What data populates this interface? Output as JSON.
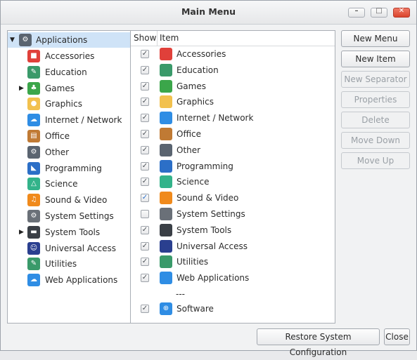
{
  "window": {
    "title": "Main Menu",
    "minimize_glyph": "–",
    "maximize_glyph": "□",
    "close_glyph": "✕"
  },
  "tree": {
    "root": {
      "label": "Applications",
      "icon": "applications-icon"
    },
    "items": [
      {
        "label": "Accessories",
        "icon": "accessories-icon",
        "color": "#e0403a"
      },
      {
        "label": "Education",
        "icon": "education-icon",
        "color": "#3a9a6a"
      },
      {
        "label": "Games",
        "icon": "games-icon",
        "color": "#3ba64a"
      },
      {
        "label": "Graphics",
        "icon": "graphics-icon",
        "color": "#f2c14e"
      },
      {
        "label": "Internet / Network",
        "icon": "internet-icon",
        "color": "#2f8de4"
      },
      {
        "label": "Office",
        "icon": "office-icon",
        "color": "#c07a34"
      },
      {
        "label": "Other",
        "icon": "other-icon",
        "color": "#5a6470"
      },
      {
        "label": "Programming",
        "icon": "programming-icon",
        "color": "#2c6fc7"
      },
      {
        "label": "Science",
        "icon": "science-icon",
        "color": "#33b38a"
      },
      {
        "label": "Sound & Video",
        "icon": "sound-video-icon",
        "color": "#f08a1c"
      },
      {
        "label": "System Settings",
        "icon": "system-settings-icon",
        "color": "#6a7078"
      },
      {
        "label": "System Tools",
        "icon": "system-tools-icon",
        "color": "#3a3f46"
      },
      {
        "label": "Universal Access",
        "icon": "universal-access-icon",
        "color": "#2a3f8f"
      },
      {
        "label": "Utilities",
        "icon": "utilities-icon",
        "color": "#3a9a6a"
      },
      {
        "label": "Web Applications",
        "icon": "web-applications-icon",
        "color": "#2f8de4"
      }
    ]
  },
  "list": {
    "header_show": "Show",
    "header_item": "Item",
    "rows": [
      {
        "label": "Accessories",
        "checked": true
      },
      {
        "label": "Education",
        "checked": true
      },
      {
        "label": "Games",
        "checked": true
      },
      {
        "label": "Graphics",
        "checked": true
      },
      {
        "label": "Internet / Network",
        "checked": true
      },
      {
        "label": "Office",
        "checked": true
      },
      {
        "label": "Other",
        "checked": true
      },
      {
        "label": "Programming",
        "checked": true
      },
      {
        "label": "Science",
        "checked": true
      },
      {
        "label": "Sound & Video",
        "checked": true
      },
      {
        "label": "System Settings",
        "checked": false
      },
      {
        "label": "System Tools",
        "checked": true
      },
      {
        "label": "Universal Access",
        "checked": true
      },
      {
        "label": "Utilities",
        "checked": true
      },
      {
        "label": "Web Applications",
        "checked": true
      }
    ],
    "separator": "---",
    "software": {
      "label": "Software",
      "checked": true
    },
    "check_mark": "✓"
  },
  "buttons": {
    "new_menu": "New Menu",
    "new_item": "New Item",
    "new_separator": "New Separator",
    "properties": "Properties",
    "delete": "Delete",
    "move_down": "Move Down",
    "move_up": "Move Up"
  },
  "footer": {
    "restore": "Restore System Configuration",
    "close": "Close"
  },
  "colors": {
    "selection": "#cfe3f7",
    "accent": "#2f8de4"
  }
}
